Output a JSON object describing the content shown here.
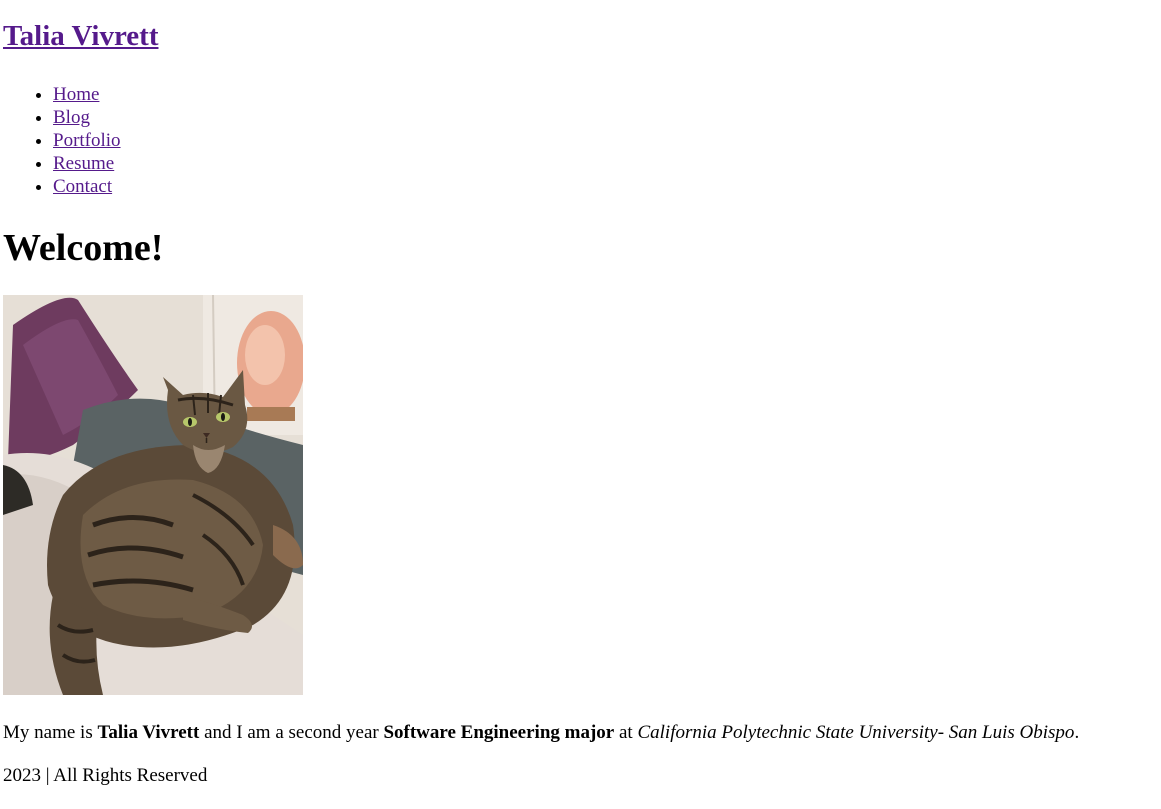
{
  "header": {
    "site_title": "Talia Vivrett"
  },
  "nav": {
    "items": [
      {
        "label": "Home"
      },
      {
        "label": "Blog"
      },
      {
        "label": "Portfolio"
      },
      {
        "label": "Resume"
      },
      {
        "label": "Contact"
      }
    ]
  },
  "main": {
    "heading": "Welcome!",
    "photo": {
      "subject": "tabby-cat-photo"
    },
    "intro": {
      "part1": "My name is ",
      "name": "Talia Vivrett",
      "part2": " and I am a second year ",
      "major": "Software Engineering major",
      "part3": " at ",
      "school": "California Polytechnic State University- San Luis Obispo",
      "part4": "."
    }
  },
  "footer": {
    "text": "2023 | All Rights Reserved"
  },
  "colors": {
    "link": "#551a8b",
    "text": "#000000",
    "background": "#ffffff"
  }
}
